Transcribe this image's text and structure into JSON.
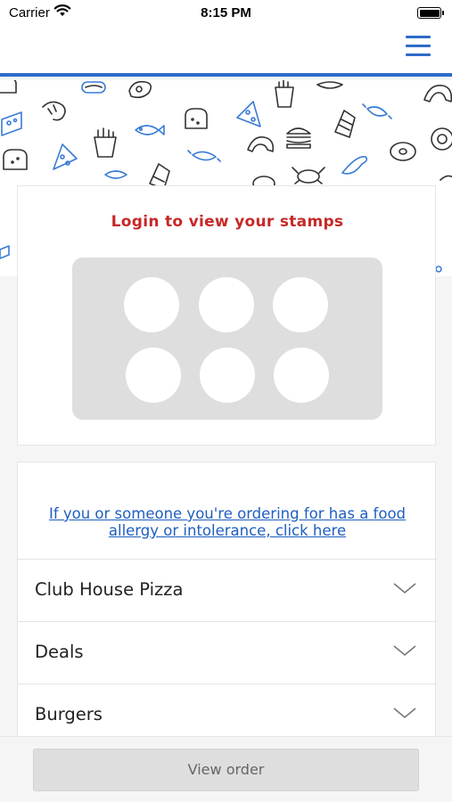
{
  "status_bar": {
    "carrier": "Carrier",
    "time": "8:15 PM",
    "wifi_icon": "wifi-icon",
    "battery_icon": "battery-icon",
    "battery_level": 1.0
  },
  "nav": {
    "menu_icon": "hamburger-menu-icon",
    "accent_color": "#2e6bc9"
  },
  "pattern": {
    "icons": [
      "bread-icon",
      "shrimp-icon",
      "hotdog-icon",
      "steak-icon",
      "fries-icon",
      "croissant-icon",
      "cheese-icon",
      "pizza-slice-icon",
      "fish-icon",
      "burger-icon",
      "sandwich-icon",
      "sausage-icon",
      "donut-icon",
      "crab-icon",
      "baguette-icon",
      "egg-icon"
    ],
    "color": "#3a7bd5"
  },
  "stamps": {
    "title": "Login to view your stamps",
    "title_color": "#c62828",
    "count": 6
  },
  "menu": {
    "allergy_link": "If you or someone you're ordering for has a food allergy or intolerance, click here",
    "link_color": "#1f5fbf",
    "categories": [
      {
        "label": "Club House Pizza",
        "icon": "chevron-down-icon"
      },
      {
        "label": "Deals",
        "icon": "chevron-down-icon"
      },
      {
        "label": "Burgers",
        "icon": "chevron-down-icon"
      }
    ]
  },
  "bottom": {
    "view_order_label": "View order"
  }
}
